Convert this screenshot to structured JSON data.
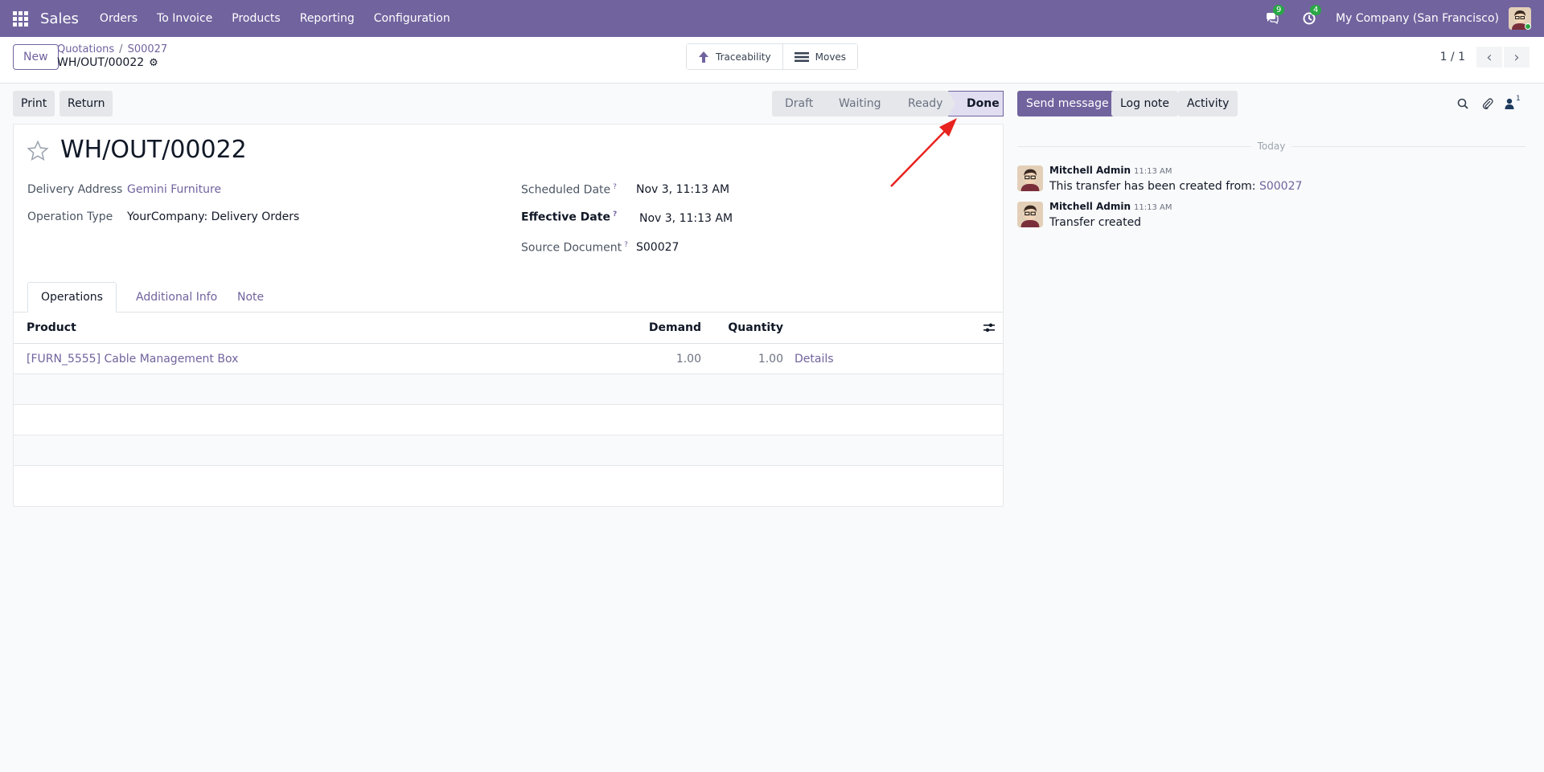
{
  "navbar": {
    "app_name": "Sales",
    "menu": [
      "Orders",
      "To Invoice",
      "Products",
      "Reporting",
      "Configuration"
    ],
    "messages_count": "9",
    "activities_count": "4",
    "company": "My Company (San Francisco)"
  },
  "control_panel": {
    "new_label": "New",
    "breadcrumb": [
      "Quotations",
      "S00027"
    ],
    "record_name": "WH/OUT/00022",
    "smart_buttons": [
      "Traceability",
      "Moves"
    ],
    "pager": "1 / 1"
  },
  "actions": {
    "print_label": "Print",
    "return_label": "Return"
  },
  "statusbar": {
    "stages": [
      "Draft",
      "Waiting",
      "Ready",
      "Done"
    ],
    "active": "Done"
  },
  "form": {
    "title": "WH/OUT/00022",
    "fields": {
      "delivery_address": {
        "label": "Delivery Address",
        "value": "Gemini Furniture"
      },
      "operation_type": {
        "label": "Operation Type",
        "value": "YourCompany: Delivery Orders"
      },
      "scheduled_date": {
        "label": "Scheduled Date",
        "value": "Nov 3, 11:13 AM",
        "help": "?"
      },
      "effective_date": {
        "label": "Effective Date",
        "value": "Nov 3, 11:13 AM",
        "help": "?"
      },
      "source_document": {
        "label": "Source Document",
        "value": "S00027",
        "help": "?"
      }
    },
    "tabs": [
      "Operations",
      "Additional Info",
      "Note"
    ],
    "table": {
      "headers": [
        "Product",
        "Demand",
        "Quantity"
      ],
      "rows": [
        {
          "product": "[FURN_5555] Cable Management Box",
          "demand": "1.00",
          "quantity": "1.00",
          "details": "Details"
        }
      ]
    }
  },
  "chatter": {
    "send_message": "Send message",
    "log_note": "Log note",
    "activity": "Activity",
    "followers_count": "1",
    "date_separator": "Today",
    "messages": [
      {
        "author": "Mitchell Admin",
        "time": "11:13 AM",
        "body": "This transfer has been created from: ",
        "link": "S00027"
      },
      {
        "author": "Mitchell Admin",
        "time": "11:13 AM",
        "body": "Transfer created"
      }
    ]
  },
  "colors": {
    "brand": "#71639e",
    "annotation_arrow": "#e8231f"
  }
}
